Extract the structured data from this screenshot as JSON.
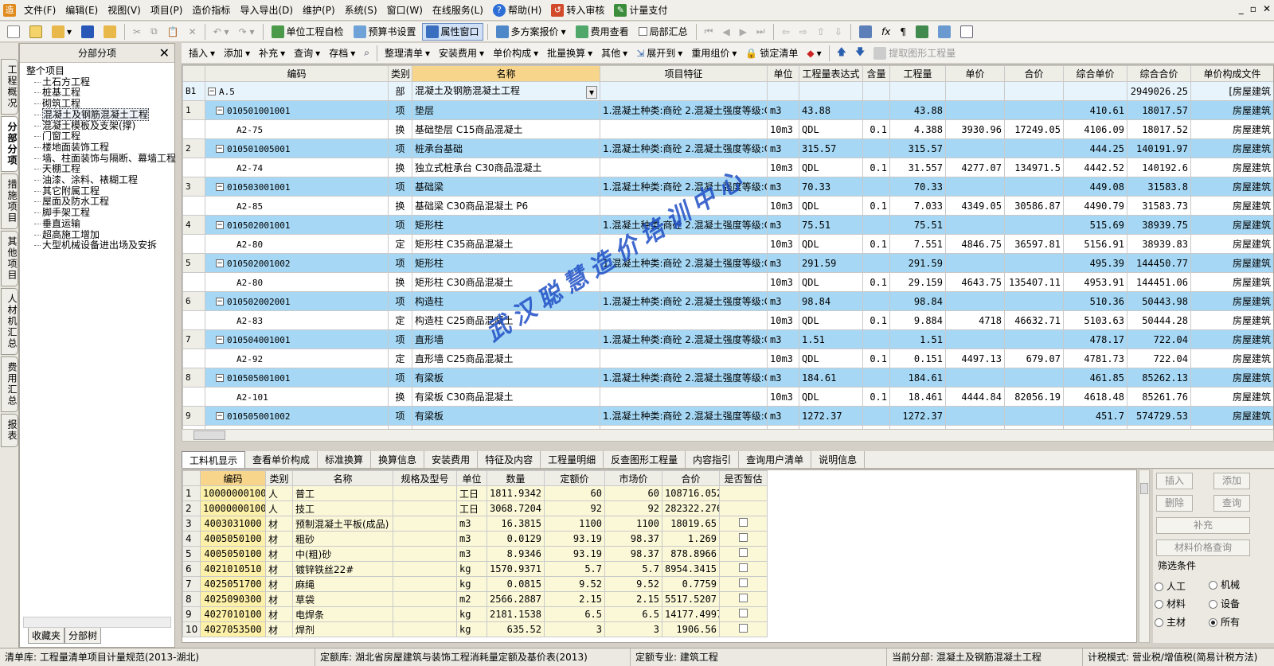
{
  "menu": {
    "items": [
      "文件(F)",
      "编辑(E)",
      "视图(V)",
      "项目(P)",
      "造价指标",
      "导入导出(D)",
      "维护(P)",
      "系统(S)",
      "窗口(W)",
      "在线服务(L)",
      "帮助(H)",
      "转入审核",
      "计量支付"
    ]
  },
  "toolbar1": {
    "check": "单位工程自检",
    "budget": "预算书设置",
    "attr": "属性窗口",
    "multi": "多方案报价",
    "fee": "费用查看",
    "local": "局部汇总"
  },
  "toolbar2": {
    "items": [
      "插入",
      "添加",
      "补充",
      "查询",
      "存档",
      "整理清单",
      "安装费用",
      "单价构成",
      "批量换算",
      "其他",
      "展开到",
      "重用组价",
      "锁定清单",
      "提取图形工程量"
    ]
  },
  "lefttabs": [
    "工程概况",
    "分部分项",
    "措施项目",
    "其他项目",
    "人材机汇总",
    "费用汇总",
    "报表"
  ],
  "leftpanel": {
    "title": "分部分项",
    "root": "整个项目",
    "nodes": [
      "土石方工程",
      "桩基工程",
      "砌筑工程",
      "混凝土及钢筋混凝土工程",
      "混凝土模板及支架(撑)",
      "门窗工程",
      "楼地面装饰工程",
      "墙、柱面装饰与隔断、幕墙工程",
      "天棚工程",
      "油漆、涂料、裱糊工程",
      "其它附属工程",
      "屋面及防水工程",
      "脚手架工程",
      "垂直运输",
      "超高施工增加",
      "大型机械设备进出场及安拆"
    ],
    "tabs": [
      "收藏夹",
      "分部树"
    ]
  },
  "grid": {
    "headers": [
      "编码",
      "类别",
      "名称",
      "项目特征",
      "单位",
      "工程量表达式",
      "含量",
      "工程量",
      "单价",
      "合价",
      "综合单价",
      "综合合价",
      "单价构成文件"
    ],
    "rows": [
      {
        "type": "b",
        "rn": "B1",
        "code": "A.5",
        "cat": "部",
        "name": "混凝土及钢筋混凝土工程",
        "feat": "",
        "unit": "",
        "expr": "",
        "qty_ratio": "",
        "qty": "",
        "price": "",
        "total": "",
        "uprice": "",
        "utotal": "2949026.25",
        "file": "[房屋建筑"
      },
      {
        "type": "q",
        "rn": "1",
        "code": "010501001001",
        "cat": "项",
        "name": "垫层",
        "feat": "1.混凝土种类:商砼\n2.混凝土强度等级:C15",
        "unit": "m3",
        "expr": "43.88",
        "qty_ratio": "",
        "qty": "43.88",
        "price": "",
        "total": "",
        "uprice": "410.61",
        "utotal": "18017.57",
        "file": "房屋建筑"
      },
      {
        "type": "d",
        "rn": "",
        "code": "A2-75",
        "cat": "换",
        "name": "基础垫层 C15商品混凝土",
        "feat": "",
        "unit": "10m3",
        "expr": "QDL",
        "qty_ratio": "0.1",
        "qty": "4.388",
        "price": "3930.96",
        "total": "17249.05",
        "uprice": "4106.09",
        "utotal": "18017.52",
        "file": "房屋建筑"
      },
      {
        "type": "q",
        "rn": "2",
        "code": "010501005001",
        "cat": "项",
        "name": "桩承台基础",
        "feat": "1.混凝土种类:商砼\n2.混凝土强度等级:C30",
        "unit": "m3",
        "expr": "315.57",
        "qty_ratio": "",
        "qty": "315.57",
        "price": "",
        "total": "",
        "uprice": "444.25",
        "utotal": "140191.97",
        "file": "房屋建筑"
      },
      {
        "type": "d",
        "rn": "",
        "code": "A2-74",
        "cat": "换",
        "name": "独立式桩承台 C30商品混凝土",
        "feat": "",
        "unit": "10m3",
        "expr": "QDL",
        "qty_ratio": "0.1",
        "qty": "31.557",
        "price": "4277.07",
        "total": "134971.5",
        "uprice": "4442.52",
        "utotal": "140192.6",
        "file": "房屋建筑"
      },
      {
        "type": "q",
        "rn": "3",
        "code": "010503001001",
        "cat": "项",
        "name": "基础梁",
        "feat": "1.混凝土种类:商砼\n2.混凝土强度等级:C30 P6",
        "unit": "m3",
        "expr": "70.33",
        "qty_ratio": "",
        "qty": "70.33",
        "price": "",
        "total": "",
        "uprice": "449.08",
        "utotal": "31583.8",
        "file": "房屋建筑"
      },
      {
        "type": "d",
        "rn": "",
        "code": "A2-85",
        "cat": "换",
        "name": "基础梁 C30商品混凝土  P6",
        "feat": "",
        "unit": "10m3",
        "expr": "QDL",
        "qty_ratio": "0.1",
        "qty": "7.033",
        "price": "4349.05",
        "total": "30586.87",
        "uprice": "4490.79",
        "utotal": "31583.73",
        "file": "房屋建筑"
      },
      {
        "type": "q",
        "rn": "4",
        "code": "010502001001",
        "cat": "项",
        "name": "矩形柱",
        "feat": "1.混凝土种类:商砼\n2.混凝土强度等级:C35",
        "unit": "m3",
        "expr": "75.51",
        "qty_ratio": "",
        "qty": "75.51",
        "price": "",
        "total": "",
        "uprice": "515.69",
        "utotal": "38939.75",
        "file": "房屋建筑"
      },
      {
        "type": "d",
        "rn": "",
        "code": "A2-80",
        "cat": "定",
        "name": "矩形柱 C35商品混凝土",
        "feat": "",
        "unit": "10m3",
        "expr": "QDL",
        "qty_ratio": "0.1",
        "qty": "7.551",
        "price": "4846.75",
        "total": "36597.81",
        "uprice": "5156.91",
        "utotal": "38939.83",
        "file": "房屋建筑"
      },
      {
        "type": "q",
        "rn": "5",
        "code": "010502001002",
        "cat": "项",
        "name": "矩形柱",
        "feat": "1.混凝土种类:商砼\n2.混凝土强度等级:C30",
        "unit": "m3",
        "expr": "291.59",
        "qty_ratio": "",
        "qty": "291.59",
        "price": "",
        "total": "",
        "uprice": "495.39",
        "utotal": "144450.77",
        "file": "房屋建筑"
      },
      {
        "type": "d",
        "rn": "",
        "code": "A2-80",
        "cat": "换",
        "name": "矩形柱 C30商品混凝土",
        "feat": "",
        "unit": "10m3",
        "expr": "QDL",
        "qty_ratio": "0.1",
        "qty": "29.159",
        "price": "4643.75",
        "total": "135407.11",
        "uprice": "4953.91",
        "utotal": "144451.06",
        "file": "房屋建筑"
      },
      {
        "type": "q",
        "rn": "6",
        "code": "010502002001",
        "cat": "项",
        "name": "构造柱",
        "feat": "1.混凝土种类:商砼\n2.混凝土强度等级:C25",
        "unit": "m3",
        "expr": "98.84",
        "qty_ratio": "",
        "qty": "98.84",
        "price": "",
        "total": "",
        "uprice": "510.36",
        "utotal": "50443.98",
        "file": "房屋建筑"
      },
      {
        "type": "d",
        "rn": "",
        "code": "A2-83",
        "cat": "定",
        "name": "构造柱 C25商品混凝土",
        "feat": "",
        "unit": "10m3",
        "expr": "QDL",
        "qty_ratio": "0.1",
        "qty": "9.884",
        "price": "4718",
        "total": "46632.71",
        "uprice": "5103.63",
        "utotal": "50444.28",
        "file": "房屋建筑"
      },
      {
        "type": "q",
        "rn": "7",
        "code": "010504001001",
        "cat": "项",
        "name": "直形墙",
        "feat": "1.混凝土种类:商砼\n2.混凝土强度等级:C25",
        "unit": "m3",
        "expr": "1.51",
        "qty_ratio": "",
        "qty": "1.51",
        "price": "",
        "total": "",
        "uprice": "478.17",
        "utotal": "722.04",
        "file": "房屋建筑"
      },
      {
        "type": "d",
        "rn": "",
        "code": "A2-92",
        "cat": "定",
        "name": "直形墙 C25商品混凝土",
        "feat": "",
        "unit": "10m3",
        "expr": "QDL",
        "qty_ratio": "0.1",
        "qty": "0.151",
        "price": "4497.13",
        "total": "679.07",
        "uprice": "4781.73",
        "utotal": "722.04",
        "file": "房屋建筑"
      },
      {
        "type": "q",
        "rn": "8",
        "code": "010505001001",
        "cat": "项",
        "name": "有梁板",
        "feat": "1.混凝土种类:商砼\n2.混凝土强度等级:C30 P6",
        "unit": "m3",
        "expr": "184.61",
        "qty_ratio": "",
        "qty": "184.61",
        "price": "",
        "total": "",
        "uprice": "461.85",
        "utotal": "85262.13",
        "file": "房屋建筑"
      },
      {
        "type": "d",
        "rn": "",
        "code": "A2-101",
        "cat": "换",
        "name": "有梁板 C30商品混凝土",
        "feat": "",
        "unit": "10m3",
        "expr": "QDL",
        "qty_ratio": "0.1",
        "qty": "18.461",
        "price": "4444.84",
        "total": "82056.19",
        "uprice": "4618.48",
        "utotal": "85261.76",
        "file": "房屋建筑"
      },
      {
        "type": "q",
        "rn": "9",
        "code": "010505001002",
        "cat": "项",
        "name": "有梁板",
        "feat": "1.混凝土种类:商砼\n2.混凝土强度等级:C30",
        "unit": "m3",
        "expr": "1272.37",
        "qty_ratio": "",
        "qty": "1272.37",
        "price": "",
        "total": "",
        "uprice": "451.7",
        "utotal": "574729.53",
        "file": "房屋建筑"
      }
    ]
  },
  "bottomtabs": [
    "工料机显示",
    "查看单价构成",
    "标准换算",
    "换算信息",
    "安装费用",
    "特征及内容",
    "工程量明细",
    "反查图形工程量",
    "内容指引",
    "查询用户清单",
    "说明信息"
  ],
  "sub": {
    "headers": [
      "编码",
      "类别",
      "名称",
      "规格及型号",
      "单位",
      "数量",
      "定额价",
      "市场价",
      "合价",
      "是否暂估"
    ],
    "rows": [
      {
        "rn": "1",
        "code": "10000000100",
        "cat": "人",
        "name": "普工",
        "spec": "",
        "unit": "工日",
        "qty": "1811.9342",
        "dprice": "60",
        "mprice": "60",
        "total": "108716.052",
        "cb": false
      },
      {
        "rn": "2",
        "code": "10000000100",
        "cat": "人",
        "name": "技工",
        "spec": "",
        "unit": "工日",
        "qty": "3068.7204",
        "dprice": "92",
        "mprice": "92",
        "total": "282322.2768",
        "cb": false
      },
      {
        "rn": "3",
        "code": "4003031000",
        "cat": "材",
        "name": "预制混凝土平板(成品)",
        "spec": "",
        "unit": "m3",
        "qty": "16.3815",
        "dprice": "1100",
        "mprice": "1100",
        "total": "18019.65",
        "cb": true
      },
      {
        "rn": "4",
        "code": "4005050100",
        "cat": "材",
        "name": "粗砂",
        "spec": "",
        "unit": "m3",
        "qty": "0.0129",
        "dprice": "93.19",
        "mprice": "98.37",
        "total": "1.269",
        "cb": true
      },
      {
        "rn": "5",
        "code": "4005050100",
        "cat": "材",
        "name": "中(粗)砂",
        "spec": "",
        "unit": "m3",
        "qty": "8.9346",
        "dprice": "93.19",
        "mprice": "98.37",
        "total": "878.8966",
        "cb": true
      },
      {
        "rn": "6",
        "code": "4021010510",
        "cat": "材",
        "name": "镀锌铁丝22#",
        "spec": "",
        "unit": "kg",
        "qty": "1570.9371",
        "dprice": "5.7",
        "mprice": "5.7",
        "total": "8954.3415",
        "cb": true
      },
      {
        "rn": "7",
        "code": "4025051700",
        "cat": "材",
        "name": "麻绳",
        "spec": "",
        "unit": "kg",
        "qty": "0.0815",
        "dprice": "9.52",
        "mprice": "9.52",
        "total": "0.7759",
        "cb": true
      },
      {
        "rn": "8",
        "code": "4025090300",
        "cat": "材",
        "name": "草袋",
        "spec": "",
        "unit": "m2",
        "qty": "2566.2887",
        "dprice": "2.15",
        "mprice": "2.15",
        "total": "5517.5207",
        "cb": true
      },
      {
        "rn": "9",
        "code": "4027010100",
        "cat": "材",
        "name": "电焊条",
        "spec": "",
        "unit": "kg",
        "qty": "2181.1538",
        "dprice": "6.5",
        "mprice": "6.5",
        "total": "14177.4997",
        "cb": true
      },
      {
        "rn": "10",
        "code": "4027053500",
        "cat": "材",
        "name": "焊剂",
        "spec": "",
        "unit": "kg",
        "qty": "635.52",
        "dprice": "3",
        "mprice": "3",
        "total": "1906.56",
        "cb": true
      }
    ]
  },
  "sidepanel": {
    "insert": "插入",
    "add": "添加",
    "delete": "删除",
    "query": "查询",
    "supplement": "补充",
    "price_query": "材料价格查询",
    "filter_title": "筛选条件",
    "filters": [
      "人工",
      "机械",
      "材料",
      "设备",
      "主材",
      "所有"
    ],
    "selected": "所有"
  },
  "status": [
    "清单库:  工程量清单项目计量规范(2013-湖北)",
    "定额库:  湖北省房屋建筑与装饰工程消耗量定额及基价表(2013)",
    "定额专业:  建筑工程",
    "当前分部:  混凝土及钢筋混凝土工程",
    "计税模式:  营业税/增值税(简易计税方法)"
  ],
  "watermark": "武汉聪慧造价培训中心"
}
